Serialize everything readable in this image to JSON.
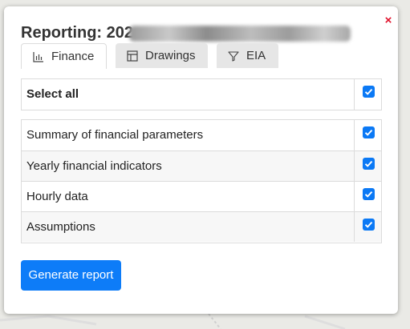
{
  "dialog": {
    "title_visible": "Reporting: 202",
    "close_symbol": "×"
  },
  "tabs": [
    {
      "label": "Finance",
      "icon": "bar-chart-icon",
      "active": true
    },
    {
      "label": "Drawings",
      "icon": "table-grid-icon",
      "active": false
    },
    {
      "label": "EIA",
      "icon": "filter-funnel-icon",
      "active": false
    }
  ],
  "select_all": {
    "label": "Select all",
    "checked": true
  },
  "report_items": [
    {
      "label": "Summary of financial parameters",
      "checked": true
    },
    {
      "label": "Yearly financial indicators",
      "checked": true
    },
    {
      "label": "Hourly data",
      "checked": true
    },
    {
      "label": "Assumptions",
      "checked": true
    }
  ],
  "actions": {
    "generate_label": "Generate report"
  },
  "colors": {
    "accent": "#0d7cf8",
    "close": "#e0102a",
    "tab_inactive_bg": "#e6e6e6"
  }
}
